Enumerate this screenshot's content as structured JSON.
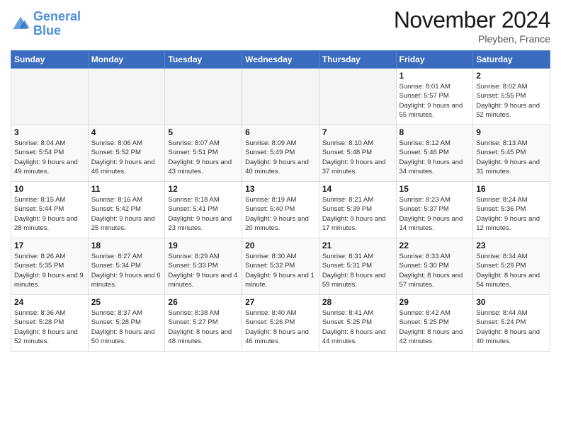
{
  "logo": {
    "text_general": "General",
    "text_blue": "Blue"
  },
  "header": {
    "title": "November 2024",
    "subtitle": "Pleyben, France"
  },
  "columns": [
    "Sunday",
    "Monday",
    "Tuesday",
    "Wednesday",
    "Thursday",
    "Friday",
    "Saturday"
  ],
  "weeks": [
    [
      {
        "day": "",
        "sunrise": "",
        "sunset": "",
        "daylight": ""
      },
      {
        "day": "",
        "sunrise": "",
        "sunset": "",
        "daylight": ""
      },
      {
        "day": "",
        "sunrise": "",
        "sunset": "",
        "daylight": ""
      },
      {
        "day": "",
        "sunrise": "",
        "sunset": "",
        "daylight": ""
      },
      {
        "day": "",
        "sunrise": "",
        "sunset": "",
        "daylight": ""
      },
      {
        "day": "1",
        "sunrise": "Sunrise: 8:01 AM",
        "sunset": "Sunset: 5:57 PM",
        "daylight": "Daylight: 9 hours and 55 minutes."
      },
      {
        "day": "2",
        "sunrise": "Sunrise: 8:02 AM",
        "sunset": "Sunset: 5:55 PM",
        "daylight": "Daylight: 9 hours and 52 minutes."
      }
    ],
    [
      {
        "day": "3",
        "sunrise": "Sunrise: 8:04 AM",
        "sunset": "Sunset: 5:54 PM",
        "daylight": "Daylight: 9 hours and 49 minutes."
      },
      {
        "day": "4",
        "sunrise": "Sunrise: 8:06 AM",
        "sunset": "Sunset: 5:52 PM",
        "daylight": "Daylight: 9 hours and 46 minutes."
      },
      {
        "day": "5",
        "sunrise": "Sunrise: 8:07 AM",
        "sunset": "Sunset: 5:51 PM",
        "daylight": "Daylight: 9 hours and 43 minutes."
      },
      {
        "day": "6",
        "sunrise": "Sunrise: 8:09 AM",
        "sunset": "Sunset: 5:49 PM",
        "daylight": "Daylight: 9 hours and 40 minutes."
      },
      {
        "day": "7",
        "sunrise": "Sunrise: 8:10 AM",
        "sunset": "Sunset: 5:48 PM",
        "daylight": "Daylight: 9 hours and 37 minutes."
      },
      {
        "day": "8",
        "sunrise": "Sunrise: 8:12 AM",
        "sunset": "Sunset: 5:46 PM",
        "daylight": "Daylight: 9 hours and 34 minutes."
      },
      {
        "day": "9",
        "sunrise": "Sunrise: 8:13 AM",
        "sunset": "Sunset: 5:45 PM",
        "daylight": "Daylight: 9 hours and 31 minutes."
      }
    ],
    [
      {
        "day": "10",
        "sunrise": "Sunrise: 8:15 AM",
        "sunset": "Sunset: 5:44 PM",
        "daylight": "Daylight: 9 hours and 28 minutes."
      },
      {
        "day": "11",
        "sunrise": "Sunrise: 8:16 AM",
        "sunset": "Sunset: 5:42 PM",
        "daylight": "Daylight: 9 hours and 25 minutes."
      },
      {
        "day": "12",
        "sunrise": "Sunrise: 8:18 AM",
        "sunset": "Sunset: 5:41 PM",
        "daylight": "Daylight: 9 hours and 23 minutes."
      },
      {
        "day": "13",
        "sunrise": "Sunrise: 8:19 AM",
        "sunset": "Sunset: 5:40 PM",
        "daylight": "Daylight: 9 hours and 20 minutes."
      },
      {
        "day": "14",
        "sunrise": "Sunrise: 8:21 AM",
        "sunset": "Sunset: 5:39 PM",
        "daylight": "Daylight: 9 hours and 17 minutes."
      },
      {
        "day": "15",
        "sunrise": "Sunrise: 8:23 AM",
        "sunset": "Sunset: 5:37 PM",
        "daylight": "Daylight: 9 hours and 14 minutes."
      },
      {
        "day": "16",
        "sunrise": "Sunrise: 8:24 AM",
        "sunset": "Sunset: 5:36 PM",
        "daylight": "Daylight: 9 hours and 12 minutes."
      }
    ],
    [
      {
        "day": "17",
        "sunrise": "Sunrise: 8:26 AM",
        "sunset": "Sunset: 5:35 PM",
        "daylight": "Daylight: 9 hours and 9 minutes."
      },
      {
        "day": "18",
        "sunrise": "Sunrise: 8:27 AM",
        "sunset": "Sunset: 5:34 PM",
        "daylight": "Daylight: 9 hours and 6 minutes."
      },
      {
        "day": "19",
        "sunrise": "Sunrise: 8:29 AM",
        "sunset": "Sunset: 5:33 PM",
        "daylight": "Daylight: 9 hours and 4 minutes."
      },
      {
        "day": "20",
        "sunrise": "Sunrise: 8:30 AM",
        "sunset": "Sunset: 5:32 PM",
        "daylight": "Daylight: 9 hours and 1 minute."
      },
      {
        "day": "21",
        "sunrise": "Sunrise: 8:31 AM",
        "sunset": "Sunset: 5:31 PM",
        "daylight": "Daylight: 8 hours and 59 minutes."
      },
      {
        "day": "22",
        "sunrise": "Sunrise: 8:33 AM",
        "sunset": "Sunset: 5:30 PM",
        "daylight": "Daylight: 8 hours and 57 minutes."
      },
      {
        "day": "23",
        "sunrise": "Sunrise: 8:34 AM",
        "sunset": "Sunset: 5:29 PM",
        "daylight": "Daylight: 8 hours and 54 minutes."
      }
    ],
    [
      {
        "day": "24",
        "sunrise": "Sunrise: 8:36 AM",
        "sunset": "Sunset: 5:28 PM",
        "daylight": "Daylight: 8 hours and 52 minutes."
      },
      {
        "day": "25",
        "sunrise": "Sunrise: 8:37 AM",
        "sunset": "Sunset: 5:28 PM",
        "daylight": "Daylight: 8 hours and 50 minutes."
      },
      {
        "day": "26",
        "sunrise": "Sunrise: 8:38 AM",
        "sunset": "Sunset: 5:27 PM",
        "daylight": "Daylight: 8 hours and 48 minutes."
      },
      {
        "day": "27",
        "sunrise": "Sunrise: 8:40 AM",
        "sunset": "Sunset: 5:26 PM",
        "daylight": "Daylight: 8 hours and 46 minutes."
      },
      {
        "day": "28",
        "sunrise": "Sunrise: 8:41 AM",
        "sunset": "Sunset: 5:25 PM",
        "daylight": "Daylight: 8 hours and 44 minutes."
      },
      {
        "day": "29",
        "sunrise": "Sunrise: 8:42 AM",
        "sunset": "Sunset: 5:25 PM",
        "daylight": "Daylight: 8 hours and 42 minutes."
      },
      {
        "day": "30",
        "sunrise": "Sunrise: 8:44 AM",
        "sunset": "Sunset: 5:24 PM",
        "daylight": "Daylight: 8 hours and 40 minutes."
      }
    ]
  ]
}
